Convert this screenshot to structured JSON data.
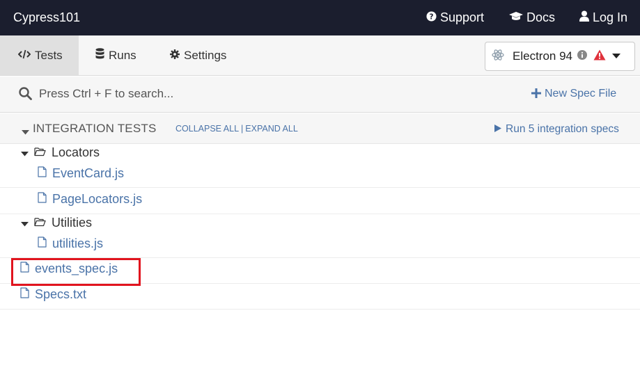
{
  "topbar": {
    "app_title": "Cypress101",
    "support_label": "Support",
    "docs_label": "Docs",
    "login_label": "Log In"
  },
  "tabs": [
    {
      "label": "Tests",
      "icon": "code-icon",
      "active": true
    },
    {
      "label": "Runs",
      "icon": "database-icon",
      "active": false
    },
    {
      "label": "Settings",
      "icon": "gear-icon",
      "active": false
    }
  ],
  "browser": {
    "label": "Electron 94",
    "icons": [
      "electron-icon",
      "info-icon",
      "warning-icon",
      "caret-down-icon"
    ]
  },
  "search": {
    "placeholder": "Press Ctrl + F to search...",
    "new_spec_label": "New Spec File"
  },
  "integration": {
    "title": "INTEGRATION TESTS",
    "collapse_all": "COLLAPSE ALL",
    "separator": "|",
    "expand_all": "EXPAND ALL",
    "run_label": "Run 5 integration specs"
  },
  "specs": {
    "folder_locators": "Locators",
    "file_eventcard": "EventCard.js",
    "file_pagelocators": "PageLocators.js",
    "folder_utilities": "Utilities",
    "file_utilities": "utilities.js",
    "file_events_spec": "events_spec.js",
    "file_specs_txt": "Specs.txt"
  },
  "colors": {
    "topbar_bg": "#1b1e2e",
    "link_blue": "#4a73a8",
    "highlight_red": "#e1141e",
    "warning_red": "#e0323c"
  }
}
